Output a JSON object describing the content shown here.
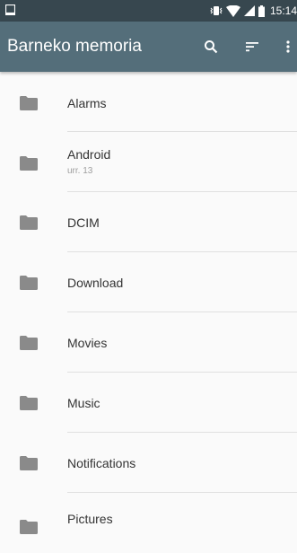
{
  "status_bar": {
    "time": "15:14",
    "icons": [
      "screen-icon",
      "vibrate-icon",
      "wifi-icon",
      "signal-icon",
      "battery-icon"
    ]
  },
  "app_bar": {
    "title": "Barneko memoria",
    "actions": [
      "search-icon",
      "sort-icon",
      "more-vert-icon"
    ]
  },
  "folders": [
    {
      "name": "Alarms",
      "subtitle": ""
    },
    {
      "name": "Android",
      "subtitle": "urr. 13"
    },
    {
      "name": "DCIM",
      "subtitle": ""
    },
    {
      "name": "Download",
      "subtitle": ""
    },
    {
      "name": "Movies",
      "subtitle": ""
    },
    {
      "name": "Music",
      "subtitle": ""
    },
    {
      "name": "Notifications",
      "subtitle": ""
    },
    {
      "name": "Pictures",
      "subtitle": ""
    }
  ],
  "colors": {
    "status_bar": "#37474f",
    "app_bar": "#546e7a",
    "background": "#fafafa",
    "folder_icon": "#8a8a8a",
    "text_primary": "#333333",
    "text_secondary": "#9e9e9e"
  }
}
